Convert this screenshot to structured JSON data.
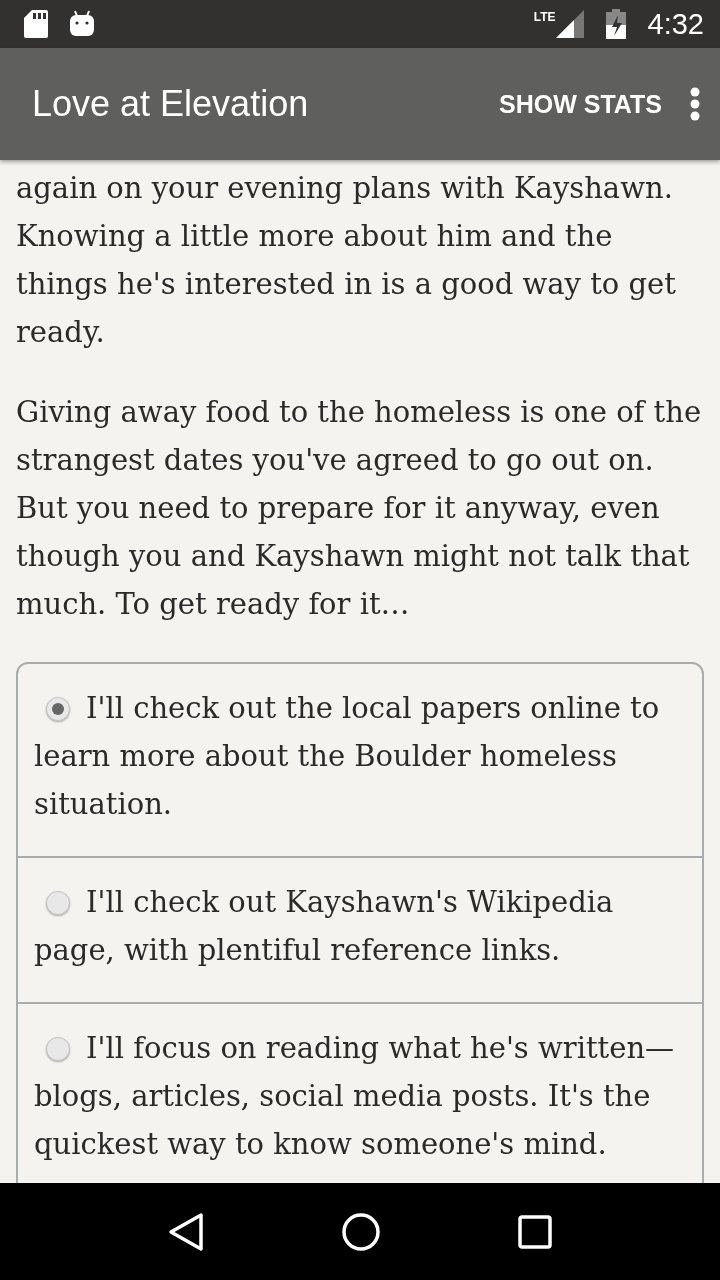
{
  "status_bar": {
    "network": "LTE",
    "time": "4:32"
  },
  "app_bar": {
    "title": "Love at Elevation",
    "action": "SHOW STATS"
  },
  "paragraphs": [
    "again on your evening plans with Kayshawn. Knowing a little more about him and the things he's interested in is a good way to get ready.",
    "Giving away food to the homeless is one of the strangest dates you've agreed to go out on. But you need to prepare for it anyway, even though you and Kayshawn might not talk that much. To get ready for it…"
  ],
  "choices": [
    {
      "label": "I'll check out the local papers online to learn more about the Boulder homeless situation.",
      "selected": true
    },
    {
      "label": "I'll check out Kayshawn's Wikipedia page, with plentiful reference links.",
      "selected": false
    },
    {
      "label": "I'll focus on reading what he's written—blogs, articles, social media posts. It's the quickest way to know someone's mind.",
      "selected": false
    }
  ]
}
